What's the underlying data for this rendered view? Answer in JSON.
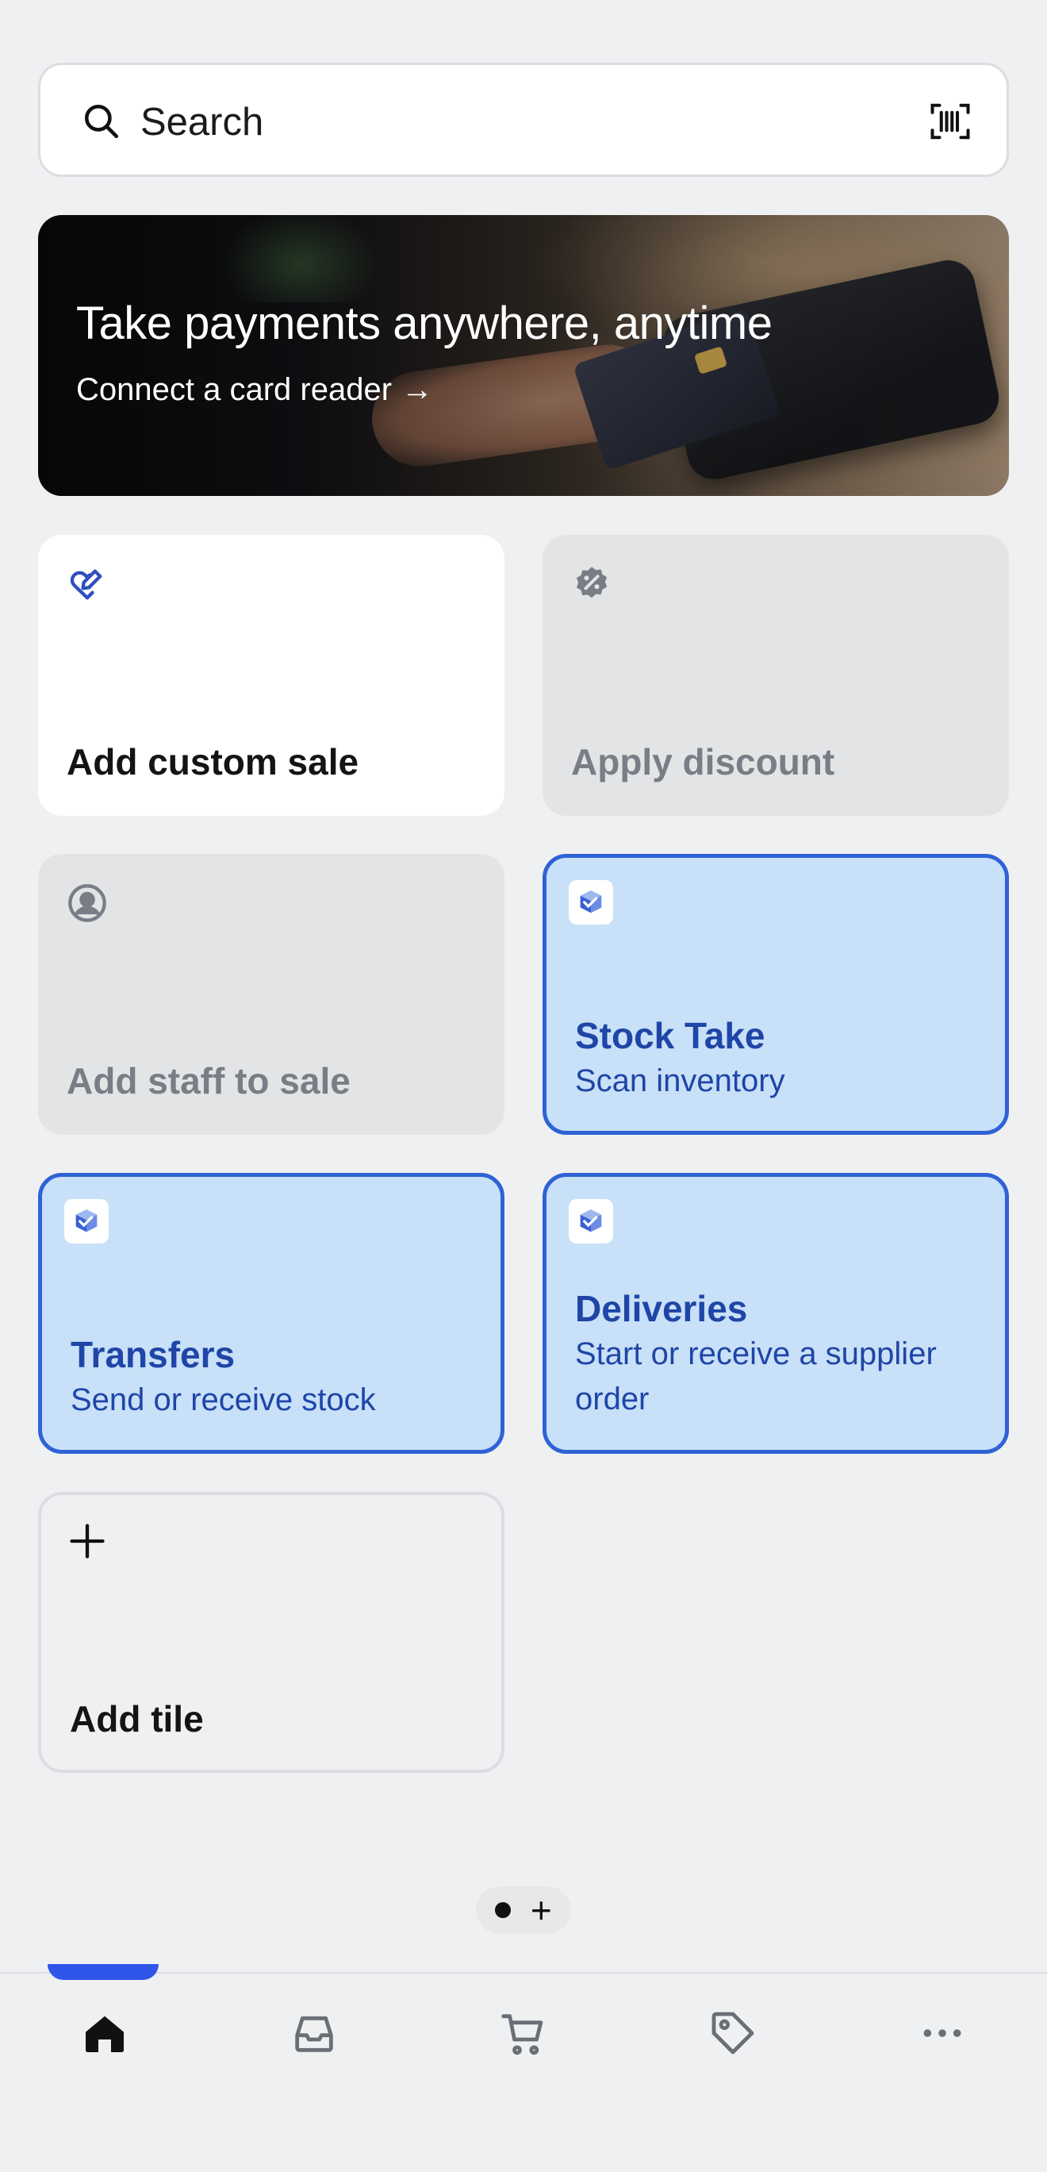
{
  "search": {
    "placeholder": "Search"
  },
  "banner": {
    "title": "Take payments anywhere, anytime",
    "link_label": "Connect a card reader",
    "arrow": "→"
  },
  "tiles": [
    {
      "label": "Add custom sale",
      "icon": "heart-edit-icon",
      "state": "enabled"
    },
    {
      "label": "Apply discount",
      "icon": "discount-badge-icon",
      "state": "disabled"
    },
    {
      "label": "Add staff to sale",
      "icon": "user-circle-icon",
      "state": "disabled"
    },
    {
      "label": "Stock Take",
      "subtitle": "Scan inventory",
      "icon": "stocky-app-icon",
      "state": "app"
    },
    {
      "label": "Transfers",
      "subtitle": "Send or receive stock",
      "icon": "stocky-app-icon",
      "state": "app"
    },
    {
      "label": "Deliveries",
      "subtitle_line1": "Start or receive a supplier",
      "subtitle_line2": "order",
      "icon": "stocky-app-icon",
      "state": "app"
    },
    {
      "label": "Add tile",
      "icon": "plus-icon",
      "state": "outline"
    }
  ],
  "pager": {
    "add": "+"
  },
  "nav": [
    {
      "name": "home",
      "icon": "home-icon",
      "active": true
    },
    {
      "name": "orders",
      "icon": "inbox-icon",
      "active": false
    },
    {
      "name": "cart",
      "icon": "cart-icon",
      "active": false
    },
    {
      "name": "products",
      "icon": "tag-icon",
      "active": false
    },
    {
      "name": "more",
      "icon": "more-icon",
      "active": false
    }
  ],
  "colors": {
    "background": "#eff0f1",
    "accent_blue": "#2f62d6",
    "tile_blue_bg": "#c8e0f8",
    "tile_blue_text": "#1f45a7",
    "disabled_text": "#7a7d86",
    "nav_indicator": "#2f55e8"
  }
}
